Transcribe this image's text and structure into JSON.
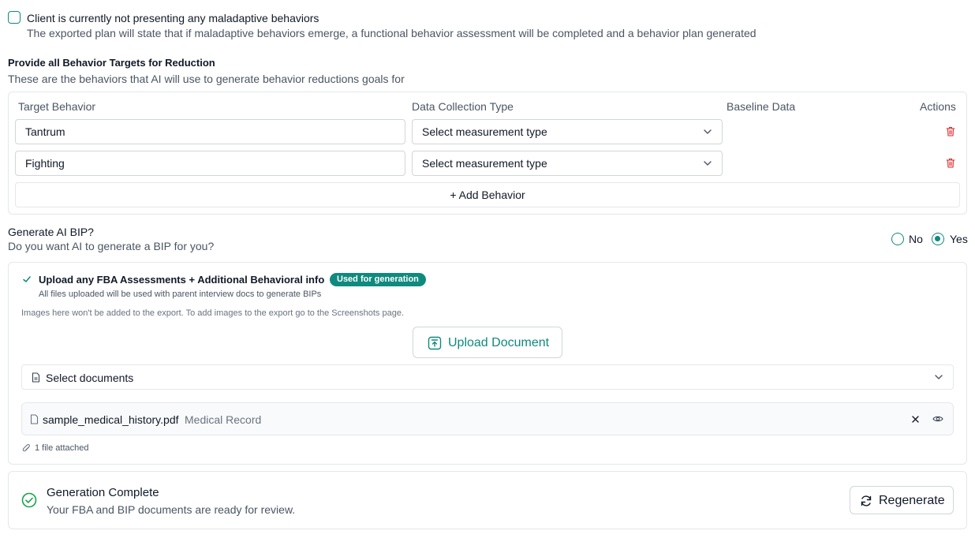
{
  "no_behaviors": {
    "label": "Client is currently not presenting any maladaptive behaviors",
    "description": "The exported plan will state that if maladaptive behaviors emerge, a functional behavior assessment will be completed and a behavior plan generated",
    "checked": false
  },
  "targets": {
    "title": "Provide all Behavior Targets for Reduction",
    "description": "These are the behaviors that AI will use to generate behavior reductions goals for",
    "columns": {
      "target": "Target Behavior",
      "data_type": "Data Collection Type",
      "baseline": "Baseline Data",
      "actions": "Actions"
    },
    "rows": [
      {
        "behavior": "Tantrum",
        "measurement": "Select measurement type"
      },
      {
        "behavior": "Fighting",
        "measurement": "Select measurement type"
      }
    ],
    "add_label": "+ Add Behavior"
  },
  "generate_bip": {
    "title": "Generate AI BIP?",
    "question": "Do you want AI to generate a BIP for you?",
    "option_no": "No",
    "option_yes": "Yes",
    "selected": "Yes"
  },
  "upload": {
    "title": "Upload any FBA Assessments + Additional Behavioral info",
    "badge": "Used for generation",
    "description": "All files uploaded will be used with parent interview docs to generate BIPs",
    "note": "Images here won't be added to the export. To add images to the export go to the Screenshots page.",
    "button": "Upload Document",
    "select_label": "Select documents",
    "files": [
      {
        "name": "sample_medical_history.pdf",
        "type": "Medical Record"
      }
    ],
    "attached_text": "1 file attached"
  },
  "status": {
    "title": "Generation Complete",
    "description": "Your FBA and BIP documents are ready for review.",
    "button": "Regenerate"
  },
  "colors": {
    "accent": "#0f8a7e",
    "success": "#16a34a",
    "danger": "#dc2626",
    "border": "#e5e7eb",
    "muted_text": "#4b5563"
  }
}
